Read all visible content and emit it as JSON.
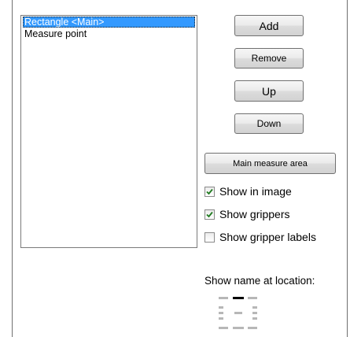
{
  "list": {
    "items": [
      {
        "label": "Rectangle <Main>",
        "selected": true
      },
      {
        "label": "Measure point",
        "selected": false
      }
    ]
  },
  "buttons": {
    "add": "Add",
    "remove": "Remove",
    "up": "Up",
    "down": "Down",
    "main_measure_area": "Main measure area"
  },
  "options": {
    "show_in_image": {
      "label": "Show in image",
      "checked": true
    },
    "show_grippers": {
      "label": "Show grippers",
      "checked": true
    },
    "show_gripper_labels": {
      "label": "Show gripper labels",
      "checked": false
    }
  },
  "name_location": {
    "label": "Show name at location:",
    "selected": "top-center",
    "icon": "name-location-picker-icon"
  }
}
